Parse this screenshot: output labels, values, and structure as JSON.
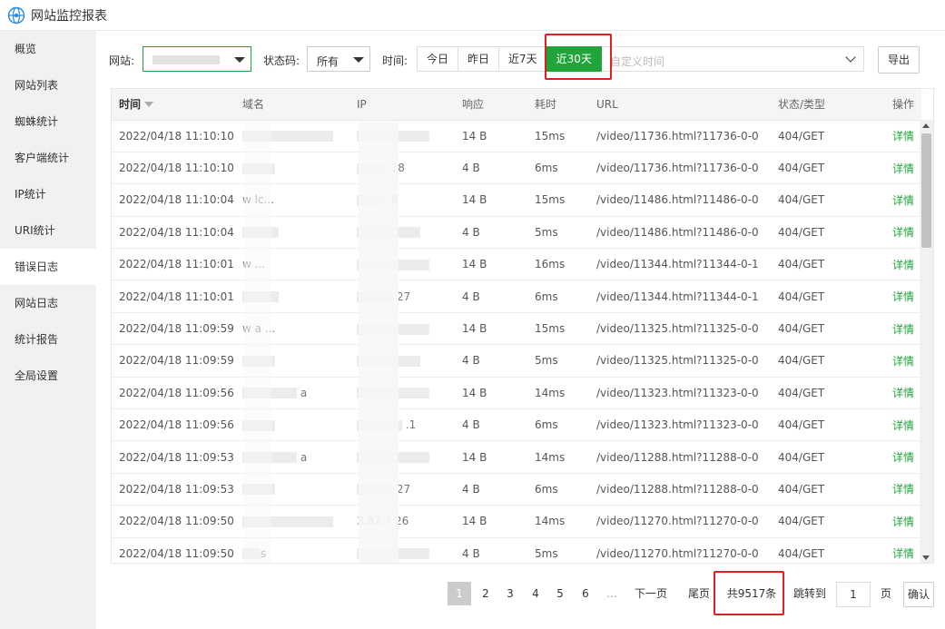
{
  "app": {
    "title": "网站监控报表"
  },
  "sidebar": {
    "items": [
      {
        "label": "概览"
      },
      {
        "label": "网站列表"
      },
      {
        "label": "蜘蛛统计"
      },
      {
        "label": "客户端统计"
      },
      {
        "label": "IP统计"
      },
      {
        "label": "URI统计"
      },
      {
        "label": "错误日志"
      },
      {
        "label": "网站日志"
      },
      {
        "label": "统计报告"
      },
      {
        "label": "全局设置"
      }
    ],
    "active": "错误日志"
  },
  "filters": {
    "site_label": "网站:",
    "status_label": "状态码:",
    "status_value": "所有",
    "time_label": "时间:",
    "time_buttons": [
      {
        "label": "今日"
      },
      {
        "label": "昨日"
      },
      {
        "label": "近7天"
      },
      {
        "label": "近30天"
      }
    ],
    "active_time": "近30天",
    "custom_time_placeholder": "自定义时间",
    "export_label": "导出"
  },
  "table": {
    "headers": {
      "time": "时间",
      "domain": "域名",
      "ip": "IP",
      "response": "响应",
      "duration": "耗时",
      "url": "URL",
      "status": "状态/类型",
      "action": "操作"
    },
    "rows": [
      {
        "time": "2022/04/18 11:10:10",
        "domain": "",
        "ip": "",
        "response": "14 B",
        "duration": "15ms",
        "url": "/video/11736.html?11736-0-0",
        "status": "404/GET",
        "action": "详情"
      },
      {
        "time": "2022/04/18 11:10:10",
        "domain": "",
        "ip": ".18",
        "response": "4 B",
        "duration": "6ms",
        "url": "/video/11736.html?11736-0-0",
        "status": "404/GET",
        "action": "详情"
      },
      {
        "time": "2022/04/18 11:10:04",
        "domain": "w lc...",
        "ip": ".8",
        "response": "14 B",
        "duration": "15ms",
        "url": "/video/11486.html?11486-0-0",
        "status": "404/GET",
        "action": "详情"
      },
      {
        "time": "2022/04/18 11:10:04",
        "domain": "",
        "ip": "",
        "response": "4 B",
        "duration": "5ms",
        "url": "/video/11486.html?11486-0-0",
        "status": "404/GET",
        "action": "详情"
      },
      {
        "time": "2022/04/18 11:10:01",
        "domain": "w ...",
        "ip": "",
        "response": "14 B",
        "duration": "16ms",
        "url": "/video/11344.html?11344-0-1",
        "status": "404/GET",
        "action": "详情"
      },
      {
        "time": "2022/04/18 11:10:01",
        "domain": "",
        "ip": "27",
        "response": "4 B",
        "duration": "6ms",
        "url": "/video/11344.html?11344-0-1",
        "status": "404/GET",
        "action": "详情"
      },
      {
        "time": "2022/04/18 11:09:59",
        "domain": "w a ...",
        "ip": "",
        "response": "14 B",
        "duration": "15ms",
        "url": "/video/11325.html?11325-0-0",
        "status": "404/GET",
        "action": "详情"
      },
      {
        "time": "2022/04/18 11:09:59",
        "domain": "",
        "ip": "",
        "response": "4 B",
        "duration": "5ms",
        "url": "/video/11325.html?11325-0-0",
        "status": "404/GET",
        "action": "详情"
      },
      {
        "time": "2022/04/18 11:09:56",
        "domain": "a",
        "ip": "",
        "response": "14 B",
        "duration": "14ms",
        "url": "/video/11323.html?11323-0-0",
        "status": "404/GET",
        "action": "详情"
      },
      {
        "time": "2022/04/18 11:09:56",
        "domain": "",
        "ip": ".1",
        "response": "4 B",
        "duration": "6ms",
        "url": "/video/11323.html?11323-0-0",
        "status": "404/GET",
        "action": "详情"
      },
      {
        "time": "2022/04/18 11:09:53",
        "domain": "a",
        "ip": "",
        "response": "14 B",
        "duration": "14ms",
        "url": "/video/11288.html?11288-0-0",
        "status": "404/GET",
        "action": "详情"
      },
      {
        "time": "2022/04/18 11:09:53",
        "domain": "",
        "ip": "27",
        "response": "4 B",
        "duration": "6ms",
        "url": "/video/11288.html?11288-0-0",
        "status": "404/GET",
        "action": "详情"
      },
      {
        "time": "2022/04/18 11:09:50",
        "domain": "",
        "ip": "3.82.7 26",
        "response": "14 B",
        "duration": "14ms",
        "url": "/video/11270.html?11270-0-0",
        "status": "404/GET",
        "action": "详情"
      },
      {
        "time": "2022/04/18 11:09:50",
        "domain": "s",
        "ip": "",
        "response": "4 B",
        "duration": "5ms",
        "url": "/video/11270.html?11270-0-0",
        "status": "404/GET",
        "action": "详情"
      }
    ]
  },
  "pagination": {
    "pages": [
      "1",
      "2",
      "3",
      "4",
      "5",
      "6"
    ],
    "current": "1",
    "ellipsis": "...",
    "next": "下一页",
    "last": "尾页",
    "total": "共9517条",
    "jump_label": "跳转到",
    "jump_value": "1",
    "page_unit": "页",
    "confirm": "确认"
  },
  "colors": {
    "accent": "#20a53a",
    "highlight": "#e02020"
  }
}
